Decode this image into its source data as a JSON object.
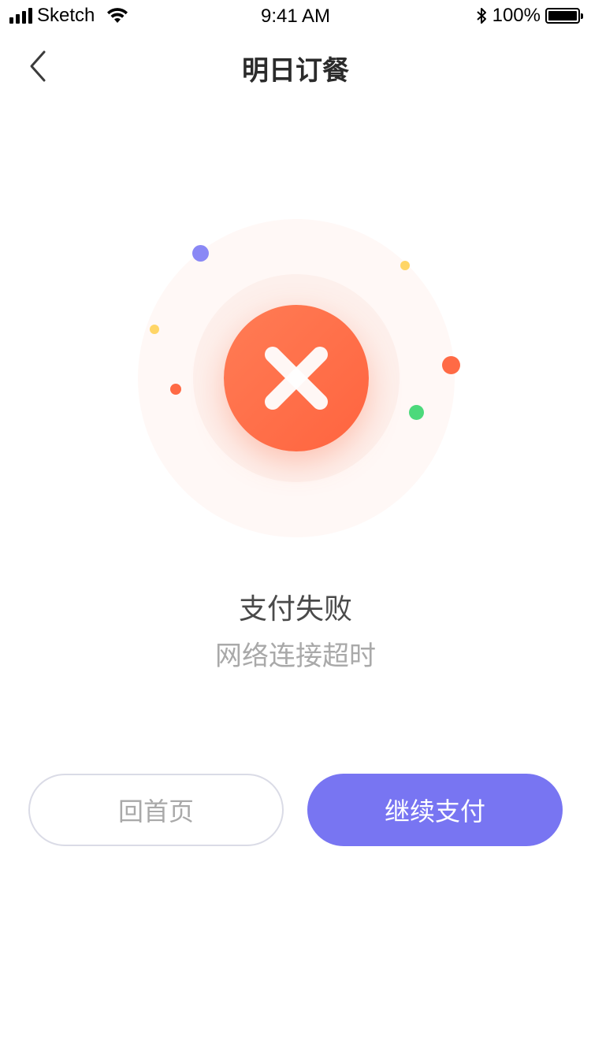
{
  "status_bar": {
    "carrier": "Sketch",
    "time": "9:41 AM",
    "battery": "100%"
  },
  "nav": {
    "title": "明日订餐",
    "back_icon": "chevron-left-icon"
  },
  "result": {
    "status_icon": "close-icon",
    "title": "支付失败",
    "subtitle": "网络连接超时"
  },
  "buttons": {
    "home_label": "回首页",
    "pay_label": "继续支付"
  },
  "colors": {
    "accent": "#7875f2",
    "error": "#ff6a45",
    "dot_yellow": "#ffd566",
    "dot_green": "#4cd97b",
    "dot_purple": "#8a88f5"
  }
}
